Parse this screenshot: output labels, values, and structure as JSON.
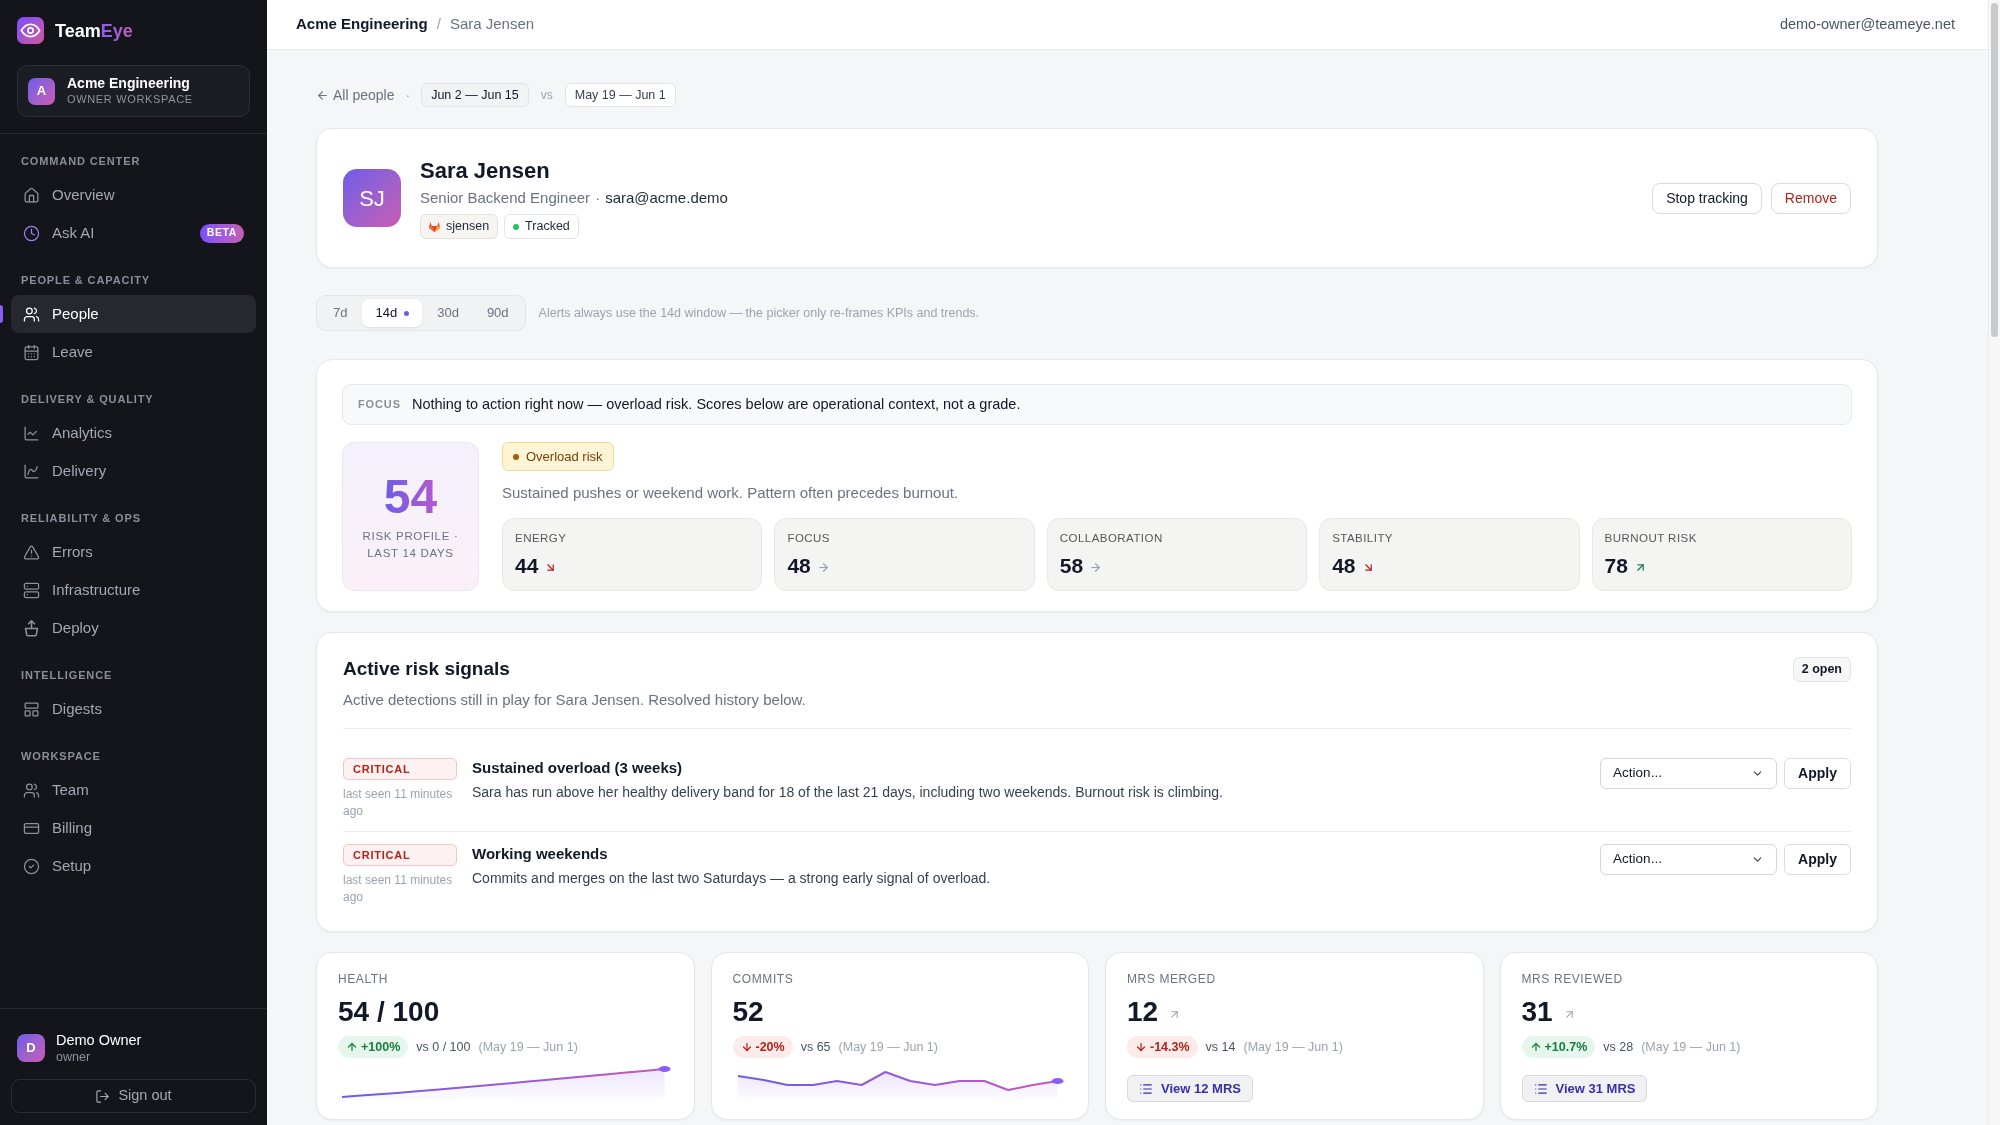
{
  "sidebar": {
    "brand": {
      "name": "Team",
      "accent": "Eye"
    },
    "workspace": {
      "initial": "A",
      "name": "Acme Engineering",
      "role": "OWNER WORKSPACE"
    },
    "sections": [
      {
        "title": "COMMAND CENTER",
        "items": [
          {
            "label": "Overview",
            "selected": false
          },
          {
            "label": "Ask AI",
            "selected": false,
            "badge": "BETA"
          }
        ]
      },
      {
        "title": "PEOPLE & CAPACITY",
        "items": [
          {
            "label": "People",
            "selected": true
          },
          {
            "label": "Leave",
            "selected": false
          }
        ]
      },
      {
        "title": "DELIVERY & QUALITY",
        "items": [
          {
            "label": "Analytics",
            "selected": false
          },
          {
            "label": "Delivery",
            "selected": false
          }
        ]
      },
      {
        "title": "RELIABILITY & OPS",
        "items": [
          {
            "label": "Errors",
            "selected": false
          },
          {
            "label": "Infrastructure",
            "selected": false
          },
          {
            "label": "Deploy",
            "selected": false
          }
        ]
      },
      {
        "title": "INTELLIGENCE",
        "items": [
          {
            "label": "Digests",
            "selected": false
          }
        ]
      },
      {
        "title": "WORKSPACE",
        "items": [
          {
            "label": "Team",
            "selected": false
          },
          {
            "label": "Billing",
            "selected": false
          },
          {
            "label": "Setup",
            "selected": false
          }
        ]
      }
    ],
    "user": {
      "initial": "D",
      "name": "Demo Owner",
      "role": "owner"
    },
    "sign_out": "Sign out"
  },
  "top_bar": {
    "breadcrumbs": [
      "Acme Engineering",
      "Sara Jensen"
    ],
    "separator": "/",
    "account": "demo-owner@teameye.net"
  },
  "filters": {
    "back_link": "All people",
    "separator": "·",
    "period": "Jun 2 — Jun 15",
    "vs": "vs",
    "comparison": "May 19 — Jun 1"
  },
  "profile": {
    "initials": "SJ",
    "name": "Sara Jensen",
    "title": "Senior Backend Engineer",
    "separator": "·",
    "email": "sara@acme.demo",
    "tags": [
      {
        "kind": "gitlab",
        "label": "sjensen"
      },
      {
        "kind": "status",
        "label": "Tracked"
      }
    ],
    "actions": [
      {
        "kind": "neutral",
        "label": "Stop tracking"
      },
      {
        "kind": "danger",
        "label": "Remove"
      }
    ]
  },
  "window_picker": {
    "options": [
      {
        "label": "7d",
        "selected": false,
        "alert_window": false
      },
      {
        "label": "14d",
        "selected": true,
        "alert_window": true
      },
      {
        "label": "30d",
        "selected": false,
        "alert_window": false
      },
      {
        "label": "90d",
        "selected": false,
        "alert_window": false
      }
    ],
    "note": "Alerts always use the 14d window — the picker only re-frames KPIs and trends."
  },
  "focus": {
    "label": "FOCUS",
    "message": "Nothing to action right now — overload risk. Scores below are operational context, not a grade.",
    "score": "54",
    "score_caption": "RISK PROFILE · LAST 14 DAYS",
    "risk_badge": "Overload risk",
    "description": "Sustained pushes or weekend work. Pattern often precedes burnout.",
    "metrics": [
      {
        "kind": "falling",
        "label": "ENERGY",
        "value": "44"
      },
      {
        "kind": "steady",
        "label": "FOCUS",
        "value": "48"
      },
      {
        "kind": "steady",
        "label": "COLLABORATION",
        "value": "58"
      },
      {
        "kind": "falling",
        "label": "STABILITY",
        "value": "48"
      },
      {
        "kind": "rising",
        "label": "BURNOUT RISK",
        "value": "78"
      }
    ]
  },
  "risk_signals": {
    "title": "Active risk signals",
    "count": "2 open",
    "subtitle": "Active detections still in play for Sara Jensen. Resolved history below.",
    "signals": [
      {
        "kind": "critical",
        "severity": "CRITICAL",
        "last_seen": "last seen 11 minutes ago",
        "title": "Sustained overload (3 weeks)",
        "description": "Sara has run above her healthy delivery band for 18 of the last 21 days, including two weekends. Burnout risk is climbing.",
        "action_select": "Action...",
        "apply": "Apply"
      },
      {
        "kind": "critical",
        "severity": "CRITICAL",
        "last_seen": "last seen 11 minutes ago",
        "title": "Working weekends",
        "description": "Commits and merges on the last two Saturdays — a strong early signal of overload.",
        "action_select": "Action...",
        "apply": "Apply"
      }
    ]
  },
  "kpis": [
    {
      "kind": "sparkline",
      "label": "HEALTH",
      "value": "54 / 100",
      "delta": {
        "kind": "up",
        "text": "+100%"
      },
      "comparison": "vs 0 / 100",
      "period": "(May 19 — Jun 1)"
    },
    {
      "kind": "sparkline",
      "label": "COMMITS",
      "value": "52",
      "delta": {
        "kind": "down",
        "text": "-20%"
      },
      "comparison": "vs 65",
      "period": "(May 19 — Jun 1)"
    },
    {
      "kind": "list",
      "label": "MRS MERGED",
      "value": "12",
      "delta": {
        "kind": "down",
        "text": "-14.3%"
      },
      "comparison": "vs 14",
      "period": "(May 19 — Jun 1)",
      "button": "View 12 MRS"
    },
    {
      "kind": "list",
      "label": "MRS REVIEWED",
      "value": "31",
      "delta": {
        "kind": "up",
        "text": "+10.7%"
      },
      "comparison": "vs 28",
      "period": "(May 19 — Jun 1)",
      "button": "View 31 MRS"
    }
  ]
}
